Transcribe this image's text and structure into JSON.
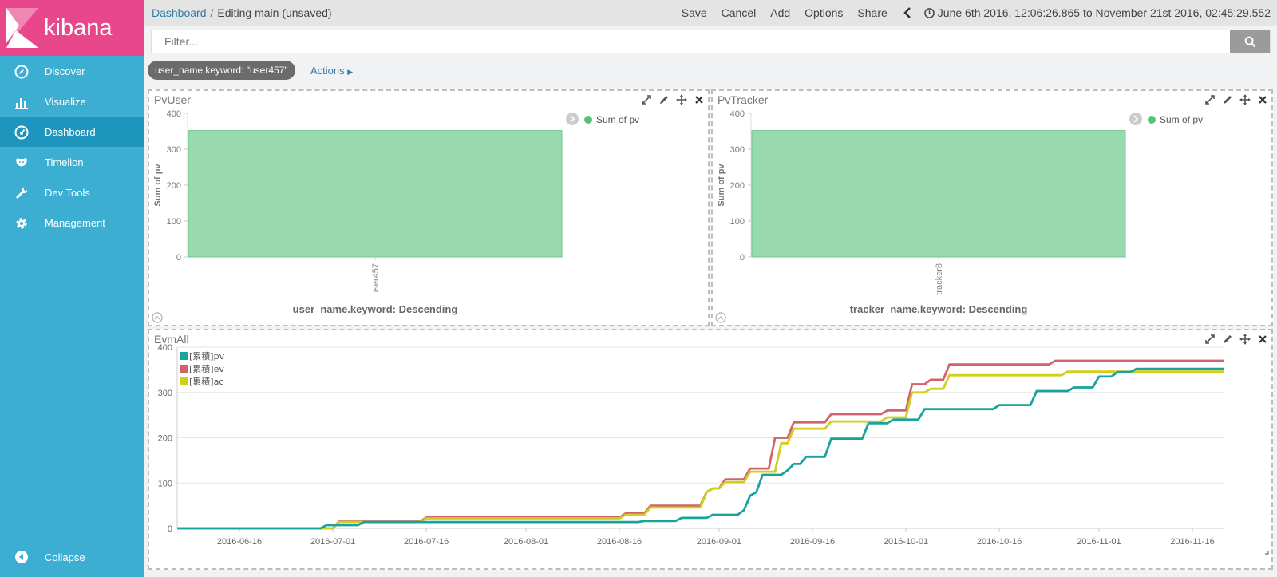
{
  "app": {
    "brand": "kibana",
    "accent": "#e8488b",
    "sidebar_bg": "#3caed2",
    "sidebar_active_bg": "#1d95bd"
  },
  "sidebar": {
    "items": [
      {
        "label": "Discover",
        "icon": "compass-icon"
      },
      {
        "label": "Visualize",
        "icon": "bar-chart-icon"
      },
      {
        "label": "Dashboard",
        "icon": "dashboard-icon",
        "active": true
      },
      {
        "label": "Timelion",
        "icon": "timelion-icon"
      },
      {
        "label": "Dev Tools",
        "icon": "wrench-icon"
      },
      {
        "label": "Management",
        "icon": "gear-icon"
      }
    ],
    "collapse_label": "Collapse"
  },
  "topbar": {
    "breadcrumb_root": "Dashboard",
    "breadcrumb_sep": "/",
    "breadcrumb_current": "Editing main (unsaved)",
    "menu": [
      "Save",
      "Cancel",
      "Add",
      "Options",
      "Share"
    ],
    "time_range": "June 6th 2016, 12:06:26.865 to November 21st 2016, 02:45:29.552"
  },
  "filter": {
    "placeholder": "Filter...",
    "value": ""
  },
  "filters": {
    "pill": "user_name.keyword: \"user457\"",
    "actions_label": "Actions"
  },
  "panels": {
    "pvuser": {
      "title": "PvUser",
      "legend": "Sum of pv",
      "ylabel": "Sum of pv",
      "xlabel": "user_name.keyword: Descending"
    },
    "pvtracker": {
      "title": "PvTracker",
      "legend": "Sum of pv",
      "ylabel": "Sum of pv",
      "xlabel": "tracker_name.keyword: Descending"
    },
    "evmall": {
      "title": "EvmAll"
    }
  },
  "chart_data": [
    {
      "type": "bar",
      "categories": [
        "user457"
      ],
      "series": [
        {
          "name": "Sum of pv",
          "values": [
            352
          ],
          "color": "#98d9ad"
        }
      ],
      "ylabel": "Sum of pv",
      "xlabel": "user_name.keyword: Descending",
      "ylim": [
        0,
        400
      ],
      "yticks": [
        0,
        100,
        200,
        300,
        400
      ],
      "legend_position": "top-right"
    },
    {
      "type": "bar",
      "categories": [
        "tracker8"
      ],
      "series": [
        {
          "name": "Sum of pv",
          "values": [
            352
          ],
          "color": "#98d9ad"
        }
      ],
      "ylabel": "Sum of pv",
      "xlabel": "tracker_name.keyword: Descending",
      "ylim": [
        0,
        400
      ],
      "yticks": [
        0,
        100,
        200,
        300,
        400
      ],
      "legend_position": "top-right"
    },
    {
      "type": "line",
      "step": true,
      "ylim": [
        0,
        400
      ],
      "yticks": [
        0,
        100,
        200,
        300,
        400
      ],
      "xlim": [
        "2016-06-06",
        "2016-11-21"
      ],
      "xticks": [
        "2016-06-16",
        "2016-07-01",
        "2016-07-16",
        "2016-08-01",
        "2016-08-16",
        "2016-09-01",
        "2016-09-16",
        "2016-10-01",
        "2016-10-16",
        "2016-11-01",
        "2016-11-16"
      ],
      "grid": true,
      "legend_position": "top-left",
      "series": [
        {
          "name": "[累積]pv",
          "color": "#1aa39c",
          "points": [
            [
              "2016-06-06",
              0
            ],
            [
              "2016-06-29",
              0
            ],
            [
              "2016-06-30",
              7
            ],
            [
              "2016-07-05",
              7
            ],
            [
              "2016-07-06",
              14
            ],
            [
              "2016-08-19",
              14
            ],
            [
              "2016-08-20",
              16
            ],
            [
              "2016-08-25",
              16
            ],
            [
              "2016-08-26",
              23
            ],
            [
              "2016-08-30",
              23
            ],
            [
              "2016-08-31",
              30
            ],
            [
              "2016-09-04",
              30
            ],
            [
              "2016-09-05",
              40
            ],
            [
              "2016-09-06",
              72
            ],
            [
              "2016-09-07",
              80
            ],
            [
              "2016-09-08",
              118
            ],
            [
              "2016-09-11",
              118
            ],
            [
              "2016-09-12",
              128
            ],
            [
              "2016-09-13",
              142
            ],
            [
              "2016-09-14",
              142
            ],
            [
              "2016-09-15",
              158
            ],
            [
              "2016-09-18",
              158
            ],
            [
              "2016-09-19",
              198
            ],
            [
              "2016-09-24",
              198
            ],
            [
              "2016-09-25",
              232
            ],
            [
              "2016-09-28",
              232
            ],
            [
              "2016-09-29",
              240
            ],
            [
              "2016-10-03",
              240
            ],
            [
              "2016-10-04",
              263
            ],
            [
              "2016-10-15",
              263
            ],
            [
              "2016-10-16",
              272
            ],
            [
              "2016-10-21",
              272
            ],
            [
              "2016-10-22",
              303
            ],
            [
              "2016-10-27",
              303
            ],
            [
              "2016-10-28",
              311
            ],
            [
              "2016-10-31",
              311
            ],
            [
              "2016-11-01",
              335
            ],
            [
              "2016-11-03",
              335
            ],
            [
              "2016-11-04",
              345
            ],
            [
              "2016-11-06",
              345
            ],
            [
              "2016-11-07",
              352
            ],
            [
              "2016-11-21",
              352
            ]
          ]
        },
        {
          "name": "[累積]ev",
          "color": "#d36269",
          "points": [
            [
              "2016-06-06",
              0
            ],
            [
              "2016-07-01",
              0
            ],
            [
              "2016-07-02",
              15
            ],
            [
              "2016-07-15",
              15
            ],
            [
              "2016-07-16",
              24
            ],
            [
              "2016-08-16",
              24
            ],
            [
              "2016-08-17",
              33
            ],
            [
              "2016-08-20",
              33
            ],
            [
              "2016-08-21",
              50
            ],
            [
              "2016-08-29",
              50
            ],
            [
              "2016-08-30",
              80
            ],
            [
              "2016-08-31",
              88
            ],
            [
              "2016-09-01",
              88
            ],
            [
              "2016-09-02",
              108
            ],
            [
              "2016-09-05",
              108
            ],
            [
              "2016-09-06",
              132
            ],
            [
              "2016-09-09",
              132
            ],
            [
              "2016-09-10",
              200
            ],
            [
              "2016-09-12",
              200
            ],
            [
              "2016-09-13",
              234
            ],
            [
              "2016-09-18",
              234
            ],
            [
              "2016-09-19",
              252
            ],
            [
              "2016-09-27",
              252
            ],
            [
              "2016-09-28",
              260
            ],
            [
              "2016-10-01",
              260
            ],
            [
              "2016-10-02",
              318
            ],
            [
              "2016-10-04",
              318
            ],
            [
              "2016-10-05",
              328
            ],
            [
              "2016-10-07",
              328
            ],
            [
              "2016-10-08",
              362
            ],
            [
              "2016-10-24",
              362
            ],
            [
              "2016-10-25",
              370
            ],
            [
              "2016-11-21",
              370
            ]
          ]
        },
        {
          "name": "[累積]ac",
          "color": "#cfcf1d",
          "points": [
            [
              "2016-06-06",
              0
            ],
            [
              "2016-07-01",
              0
            ],
            [
              "2016-07-02",
              14
            ],
            [
              "2016-07-15",
              14
            ],
            [
              "2016-07-16",
              22
            ],
            [
              "2016-08-16",
              22
            ],
            [
              "2016-08-17",
              30
            ],
            [
              "2016-08-20",
              30
            ],
            [
              "2016-08-21",
              46
            ],
            [
              "2016-08-29",
              46
            ],
            [
              "2016-08-30",
              80
            ],
            [
              "2016-08-31",
              88
            ],
            [
              "2016-09-01",
              88
            ],
            [
              "2016-09-02",
              102
            ],
            [
              "2016-09-05",
              102
            ],
            [
              "2016-09-06",
              125
            ],
            [
              "2016-09-10",
              125
            ],
            [
              "2016-09-11",
              188
            ],
            [
              "2016-09-12",
              188
            ],
            [
              "2016-09-13",
              220
            ],
            [
              "2016-09-18",
              220
            ],
            [
              "2016-09-19",
              236
            ],
            [
              "2016-09-27",
              236
            ],
            [
              "2016-09-28",
              245
            ],
            [
              "2016-10-01",
              245
            ],
            [
              "2016-10-02",
              300
            ],
            [
              "2016-10-04",
              300
            ],
            [
              "2016-10-05",
              308
            ],
            [
              "2016-10-07",
              308
            ],
            [
              "2016-10-08",
              338
            ],
            [
              "2016-10-26",
              338
            ],
            [
              "2016-10-27",
              346
            ],
            [
              "2016-11-21",
              346
            ]
          ]
        }
      ]
    }
  ]
}
